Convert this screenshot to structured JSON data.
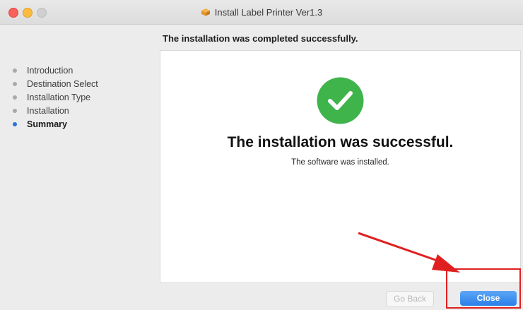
{
  "window": {
    "title": "Install Label Printer Ver1.3",
    "icons": {
      "close": "close-dot",
      "minimize": "minimize-dot",
      "zoom": "zoom-dot",
      "package": "package-icon"
    }
  },
  "header": {
    "heading": "The installation was completed successfully."
  },
  "sidebar": {
    "steps": [
      {
        "label": "Introduction",
        "active": false
      },
      {
        "label": "Destination Select",
        "active": false
      },
      {
        "label": "Installation Type",
        "active": false
      },
      {
        "label": "Installation",
        "active": false
      },
      {
        "label": "Summary",
        "active": true
      }
    ]
  },
  "panel": {
    "icon": "checkmark-icon",
    "title": "The installation was successful.",
    "subtitle": "The software was installed.",
    "accent_color": "#3fb44b"
  },
  "annotation": {
    "arrow_color": "#e02020",
    "box_color": "#e02020"
  },
  "footer": {
    "back_label": "Go Back",
    "back_enabled": false,
    "close_label": "Close",
    "close_color": "#2a7fe8"
  }
}
